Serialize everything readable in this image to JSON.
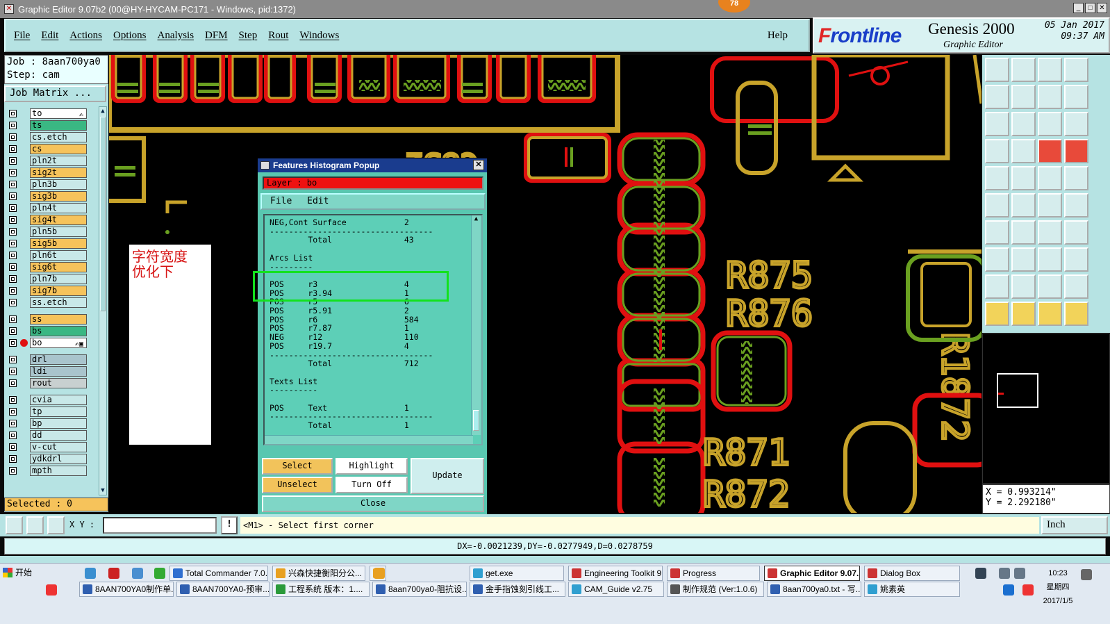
{
  "window": {
    "title": "Graphic Editor 9.07b2 (00@HY-HYCAM-PC171 - Windows, pid:1372)",
    "badge": "78"
  },
  "menu": [
    "File",
    "Edit",
    "Actions",
    "Options",
    "Analysis",
    "DFM",
    "Step",
    "Rout",
    "Windows"
  ],
  "help": "Help",
  "brand": {
    "logo_first": "F",
    "logo_rest": "rontline",
    "product": "Genesis 2000",
    "subtitle": "Graphic Editor",
    "date": "05 Jan 2017",
    "time": "09:37 AM"
  },
  "job": {
    "job_line": "Job : 8aan700ya0",
    "step_line": "Step: cam",
    "matrix_button": "Job Matrix ..."
  },
  "layers": [
    {
      "name": "to",
      "color": "#ffffff",
      "pen": "✍"
    },
    {
      "name": "ts",
      "color": "#3ab783"
    },
    {
      "name": "cs.etch",
      "color": "#c8e8e8"
    },
    {
      "name": "cs",
      "color": "#f6c35b"
    },
    {
      "name": "pln2t",
      "color": "#c8e8e8"
    },
    {
      "name": "sig2t",
      "color": "#f6c35b"
    },
    {
      "name": "pln3b",
      "color": "#c8e8e8"
    },
    {
      "name": "sig3b",
      "color": "#f6c35b"
    },
    {
      "name": "pln4t",
      "color": "#c8e8e8"
    },
    {
      "name": "sig4t",
      "color": "#f6c35b"
    },
    {
      "name": "pln5b",
      "color": "#c8e8e8"
    },
    {
      "name": "sig5b",
      "color": "#f6c35b"
    },
    {
      "name": "pln6t",
      "color": "#c8e8e8"
    },
    {
      "name": "sig6t",
      "color": "#f6c35b"
    },
    {
      "name": "pln7b",
      "color": "#c8e8e8"
    },
    {
      "name": "sig7b",
      "color": "#f6c35b"
    },
    {
      "name": "ss.etch",
      "color": "#c8e8e8"
    },
    {
      "name": "",
      "color": "#b6e3e3",
      "spacer": true
    },
    {
      "name": "ss",
      "color": "#f6c35b"
    },
    {
      "name": "bs",
      "color": "#3ab783"
    },
    {
      "name": "bo",
      "color": "#ffffff",
      "active": true,
      "pen": "✍▣"
    },
    {
      "name": "",
      "color": "#b6e3e3",
      "spacer": true
    },
    {
      "name": "drl",
      "color": "#a9c4cc"
    },
    {
      "name": "ldi",
      "color": "#a9c4cc"
    },
    {
      "name": "rout",
      "color": "#c8d0d0"
    },
    {
      "name": "",
      "color": "#b6e3e3",
      "spacer": true
    },
    {
      "name": "cvia",
      "color": "#c8e8e8"
    },
    {
      "name": "tp",
      "color": "#c8e8e8"
    },
    {
      "name": "bp",
      "color": "#c8e8e8"
    },
    {
      "name": "dd",
      "color": "#c8e8e8"
    },
    {
      "name": "v-cut",
      "color": "#c8e8e8"
    },
    {
      "name": "ydkdrl",
      "color": "#c8e8e8"
    },
    {
      "name": "mpth",
      "color": "#c8e8e8"
    }
  ],
  "selected": "Selected : 0",
  "note": {
    "line1": "字符宽度",
    "line2": "优化下"
  },
  "popup": {
    "title": "Features Histogram Popup",
    "layer_label": "Layer :  bo",
    "menu": [
      "File",
      "Edit"
    ],
    "lines": [
      "NEG,Cont Surface            2",
      "----------------------------------",
      "        Total               43",
      "",
      "Arcs List",
      "---------",
      "",
      "POS     r3                  4",
      "POS     r3.94               1",
      "POS     r5                  6",
      "POS     r5.91               2",
      "POS     r6                  584",
      "POS     r7.87               1",
      "NEG     r12                 110",
      "POS     r19.7               4",
      "----------------------------------",
      "        Total               712",
      "",
      "Texts List",
      "----------",
      "",
      "POS     Text                1",
      "----------------------------------",
      "        Total               1"
    ],
    "buttons": {
      "select": "Select",
      "highlight": "Highlight",
      "update": "Update",
      "unselect": "Unselect",
      "turnoff": "Turn Off",
      "close": "Close"
    }
  },
  "coords": {
    "x": "X = 0.993214\"",
    "y": "Y = 2.292180\""
  },
  "status": {
    "xy_label": "X Y :",
    "info": "!",
    "prompt": "<M1> - Select first corner",
    "units": "Inch",
    "dx": "DX=-0.0021239,DY=-0.0277949,D=0.0278759"
  },
  "taskbar": {
    "start": "开始",
    "row1": [
      {
        "label": "Total Commander 7.0...",
        "color": "#2f6fd0"
      },
      {
        "label": "兴森快捷衡阳分公...",
        "color": "#e8a020"
      },
      {
        "label": "",
        "color": "#e8a020"
      },
      {
        "label": "get.exe",
        "color": "#2f9fd0"
      },
      {
        "label": "Engineering Toolkit 9....",
        "color": "#c33"
      },
      {
        "label": "Progress",
        "color": "#c33"
      },
      {
        "label": "Graphic Editor 9.07...",
        "color": "#c33",
        "active": true
      },
      {
        "label": "Dialog Box",
        "color": "#c33"
      }
    ],
    "row2": [
      {
        "label": "8AAN700YA0制作单...",
        "color": "#2f5fb0"
      },
      {
        "label": "8AAN700YA0-预审...",
        "color": "#2f5fb0"
      },
      {
        "label": "工程系统  版本：1....",
        "color": "#2a9a3a"
      },
      {
        "label": "8aan700ya0-阻抗设...",
        "color": "#2f5fb0"
      },
      {
        "label": "金手指蚀刻引线工...",
        "color": "#2f5fb0"
      },
      {
        "label": "CAM_Guide v2.75",
        "color": "#2f9fd0"
      },
      {
        "label": "制作规范 (Ver:1.0.6)",
        "color": "#555"
      },
      {
        "label": "8aan700ya0.txt - 写...",
        "color": "#2f5fb0"
      },
      {
        "label": "姚素英",
        "color": "#2f9fd0"
      }
    ],
    "time": "10:23",
    "weekday": "星期四",
    "date": "2017/1/5"
  }
}
